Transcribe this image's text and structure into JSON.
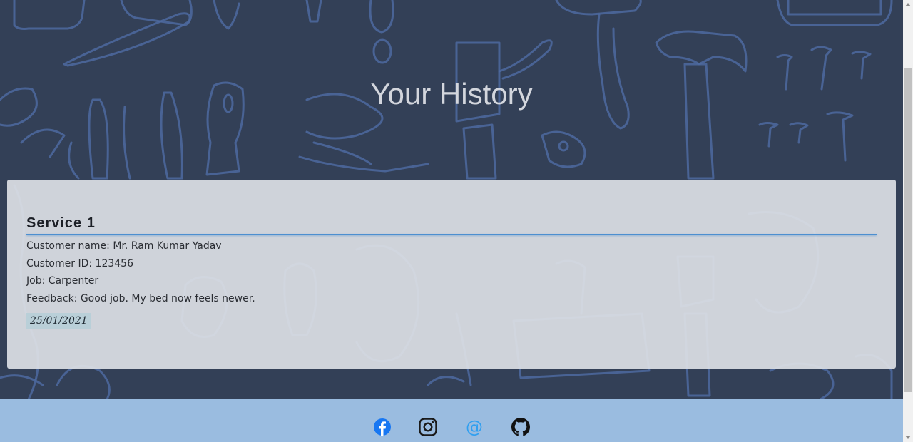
{
  "hero": {
    "title": "Your History"
  },
  "service": {
    "title": "Service 1",
    "customer_name": "Customer name: Mr. Ram Kumar Yadav",
    "customer_id": "Customer ID: 123456",
    "job": "Job: Carpenter",
    "feedback": "Feedback: Good job. My bed now feels newer.",
    "date": "25/01/2021"
  },
  "footer": {
    "social": [
      {
        "icon": "facebook-icon",
        "color": "#1877f2"
      },
      {
        "icon": "instagram-icon",
        "color": "#1a1a1a"
      },
      {
        "icon": "at-icon",
        "glyph": "@",
        "color": "#2f9ff0"
      },
      {
        "icon": "github-icon",
        "color": "#111111"
      }
    ]
  },
  "colors": {
    "background": "#334057",
    "doodle_stroke": "#4d6aa0",
    "card": "#dcdfe4",
    "accent_rule": "#4d8fd0",
    "footer": "#9abce0"
  }
}
